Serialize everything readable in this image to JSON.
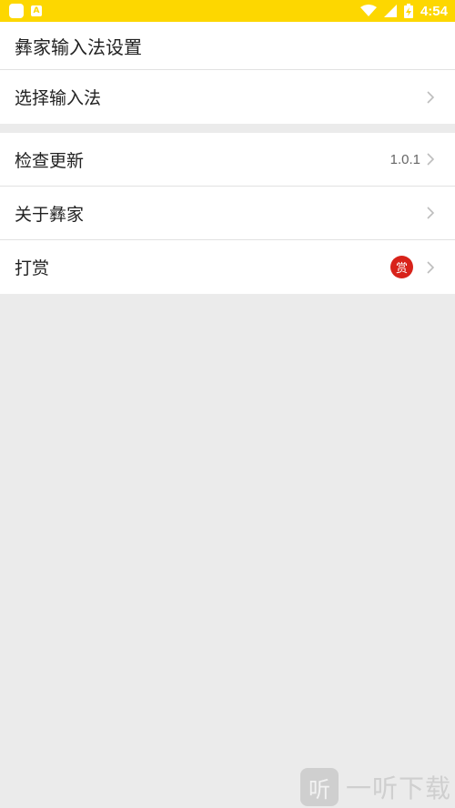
{
  "status_bar": {
    "time": "4:54",
    "icons": [
      "app-square-icon",
      "a-notification-icon",
      "wifi-icon",
      "signal-icon",
      "battery-charging-icon"
    ],
    "background": "#fdd700"
  },
  "header": {
    "title": "彝家输入法设置"
  },
  "settings": {
    "select_ime": {
      "label": "选择输入法"
    },
    "check_update": {
      "label": "检查更新",
      "version": "1.0.1"
    },
    "about": {
      "label": "关于彝家"
    },
    "reward": {
      "label": "打赏",
      "badge": "赏",
      "badge_color": "#d8221a"
    }
  },
  "watermark": {
    "logo_char": "听",
    "text": "一听下载"
  }
}
